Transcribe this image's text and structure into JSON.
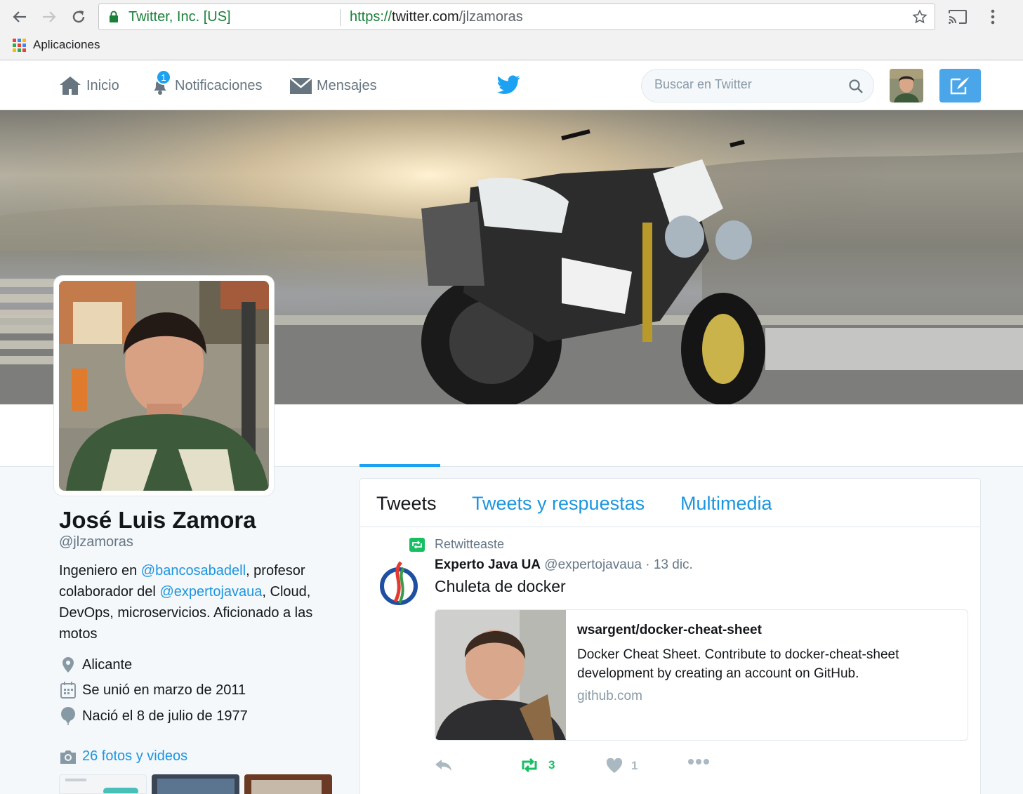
{
  "browser": {
    "back_icon": "arrow-left-icon",
    "forward_icon": "arrow-right-icon",
    "reload_icon": "reload-icon",
    "secure_label": "Twitter, Inc. [US]",
    "url_scheme": "https://",
    "url_host": "twitter.com",
    "url_path": "/jlzamoras",
    "bookmarks": [
      {
        "label": "Aplicaciones",
        "icon": "apps-grid-icon"
      }
    ],
    "colors": {
      "secure": "#188038"
    }
  },
  "topbar": {
    "nav": [
      {
        "label": "Inicio",
        "icon": "home-icon"
      },
      {
        "label": "Notificaciones",
        "icon": "bell-icon",
        "badge": "1"
      },
      {
        "label": "Mensajes",
        "icon": "envelope-icon"
      }
    ],
    "logo": "twitter-bird-icon",
    "search_placeholder": "Buscar en Twitter",
    "tweet_button_icon": "compose-icon",
    "colors": {
      "brand": "#1da1f2",
      "tweet_button": "#4aa6e8"
    }
  },
  "profile": {
    "name": "José Luis Zamora",
    "handle": "@jlzamoras",
    "bio": {
      "part1": "Ingeniero en ",
      "mention1": "@bancosabadell",
      "part2": ", profesor colaborador del ",
      "mention2": "@expertojavaua",
      "part3": ", Cloud, DevOps, microservicios. Aficionado a las motos"
    },
    "location": "Alicante",
    "joined": "Se unió en marzo de 2011",
    "birthday": "Nació el 8 de julio de 1977",
    "photos_label": "26 fotos y videos"
  },
  "timeline": {
    "tabs": [
      "Tweets",
      "Tweets y respuestas",
      "Multimedia"
    ],
    "active_tab": "Tweets",
    "tweet": {
      "context": "Retwitteaste",
      "author_name": "Experto Java UA",
      "author_handle": "@expertojavaua",
      "separator": " · ",
      "time": "13 dic.",
      "text": "Chuleta de docker",
      "card": {
        "title": "wsargent/docker-cheat-sheet",
        "description": "Docker Cheat Sheet. Contribute to docker-cheat-sheet development by creating an account on GitHub.",
        "domain": "github.com"
      },
      "retweets": "3",
      "likes": "1",
      "colors": {
        "retweet": "#17bf63",
        "muted": "#aab8c2"
      }
    }
  }
}
